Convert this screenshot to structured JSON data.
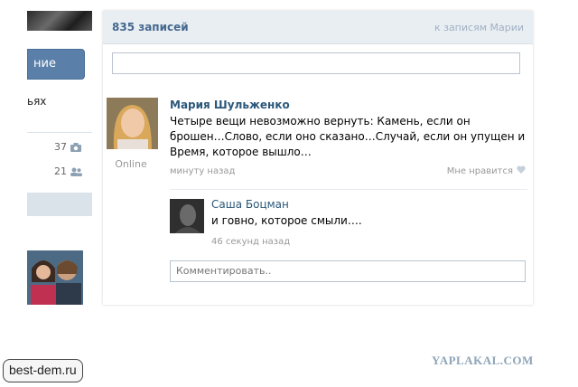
{
  "left": {
    "button_label": "ние",
    "text_fragment": "ьях",
    "photos_count": "37",
    "people_count": "21"
  },
  "wall": {
    "count_label": "835 записей",
    "link_label": "к записям Марии",
    "post": {
      "author": "Мария Шульженко",
      "status": "Online",
      "text": "Четыре вещи невозможно вернуть: Камень, если он брошен…Слово, если оно сказано…Случай, если он упущен и Время, которое вышло…",
      "time": "минуту назад",
      "like_label": "Мне нравится"
    },
    "reply": {
      "author": "Саша Боцман",
      "text": "и говно, которое смыли….",
      "time": "46 секунд назад"
    },
    "comment_placeholder": "Комментировать.."
  },
  "watermarks": {
    "left": "best-dem.ru",
    "right": "YAPLAKAL.COM"
  },
  "colors": {
    "header_bg": "#e9eef3",
    "link_blue": "#2b587a",
    "count_blue": "#45688e",
    "button_blue": "#5a7fa8"
  }
}
